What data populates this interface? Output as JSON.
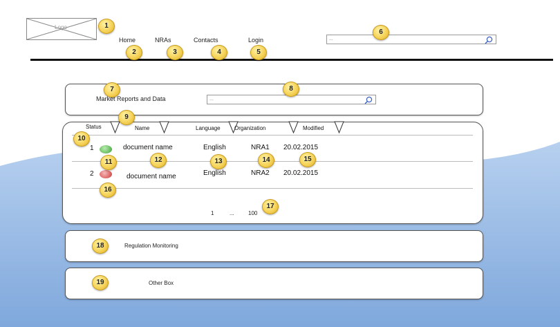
{
  "header": {
    "logo_text": "Logo",
    "nav": {
      "home": "Home",
      "nras": "NRAs",
      "contacts": "Contacts",
      "login": "Login"
    },
    "search_placeholder": "..."
  },
  "market_reports": {
    "title": "Market Reports and Data",
    "search_placeholder": "..."
  },
  "table": {
    "columns": [
      "Status",
      "Name",
      "Language",
      "Organization",
      "Modified"
    ],
    "rows": [
      {
        "index": "1",
        "status_color": "#6fc267",
        "name": "document name",
        "language": "English",
        "organization": "NRA1",
        "modified": "20.02.2015"
      },
      {
        "index": "2",
        "status_color": "#e06a6a",
        "name": "document name",
        "language": "English",
        "organization": "NRA2",
        "modified": "20.02.2015"
      }
    ],
    "pagination": {
      "first": "1",
      "ellipsis": "...",
      "last": "100"
    }
  },
  "boxes": {
    "regulation": "Regulation Monitoring",
    "other": "Other Box"
  },
  "markers": [
    "1",
    "2",
    "3",
    "4",
    "5",
    "6",
    "7",
    "8",
    "9",
    "10",
    "11",
    "12",
    "13",
    "14",
    "15",
    "16",
    "17",
    "18",
    "19"
  ],
  "colors": {
    "marker_fill": "#f5d35a",
    "background_blue": "#9dbfe8",
    "status_green": "#6fc267",
    "status_red": "#e06a6a"
  }
}
